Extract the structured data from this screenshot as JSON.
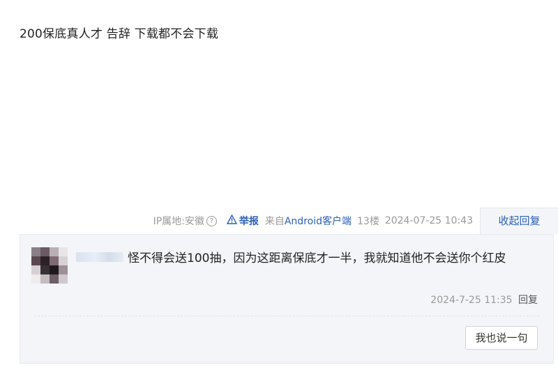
{
  "post": {
    "text": "200保底真人才 告辞 下载都不会下载"
  },
  "meta": {
    "ip_location": "IP属地:安徽",
    "help_icon": "question-circle-icon",
    "report_label": "举报",
    "source_prefix": "来自",
    "client": "Android客户端",
    "floor": "13楼",
    "timestamp": "2024-07-25 10:43",
    "collapse_label": "收起回复"
  },
  "reply": {
    "username": "",
    "text": "怪不得会送100抽，因为这距离保底才一半，我就知道他不会送你个红皮",
    "time": "2024-7-25 11:35",
    "reply_label": "回复"
  },
  "say_button_label": "我也说一句",
  "colors": {
    "link_blue": "#2b5fb8",
    "panel_bg": "#f3f5f8",
    "meta_gray": "#999999"
  }
}
